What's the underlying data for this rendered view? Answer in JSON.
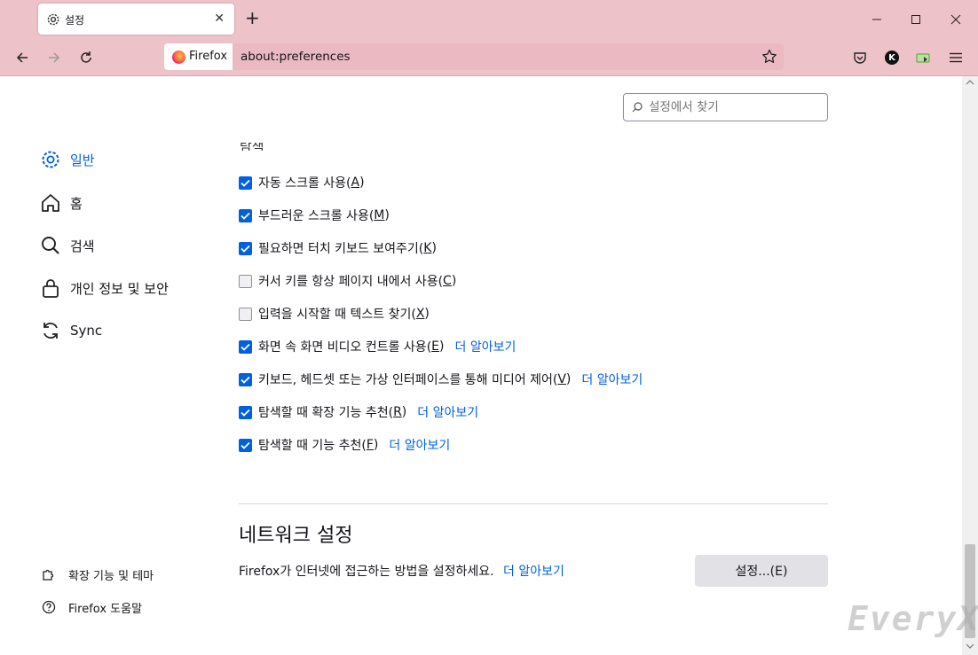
{
  "tab": {
    "title": "설정",
    "icon": "gear-icon"
  },
  "window": {
    "minimize": "minimize-icon",
    "maximize": "maximize-icon",
    "close": "close-icon"
  },
  "urlbar": {
    "identity_label": "Firefox",
    "url": "about:preferences"
  },
  "toolbar": {
    "avatar_letter": "K"
  },
  "search": {
    "placeholder": "설정에서 찾기"
  },
  "sidebar": {
    "items": [
      {
        "label": "일반",
        "icon": "gear-icon",
        "active": true
      },
      {
        "label": "홈",
        "icon": "home-icon"
      },
      {
        "label": "검색",
        "icon": "search-icon"
      },
      {
        "label": "개인 정보 및 보안",
        "icon": "lock-icon"
      },
      {
        "label": "Sync",
        "icon": "sync-icon"
      }
    ],
    "footer": [
      {
        "label": "확장 기능 및 테마",
        "icon": "puzzle-icon"
      },
      {
        "label": "Firefox 도움말",
        "icon": "help-icon"
      }
    ]
  },
  "section_partial_heading": "탐색",
  "options": [
    {
      "label": "자동 스크롤 사용(",
      "key": "A",
      "checked": true
    },
    {
      "label": "부드러운 스크롤 사용(",
      "key": "M",
      "checked": true
    },
    {
      "label": "필요하면 터치 키보드 보여주기(",
      "key": "K",
      "checked": true
    },
    {
      "label": "커서 키를 항상 페이지 내에서 사용(",
      "key": "C",
      "checked": false
    },
    {
      "label": "입력을 시작할 때 텍스트 찾기(",
      "key": "X",
      "checked": false
    },
    {
      "label": "화면 속 화면 비디오 컨트롤 사용(",
      "key": "E",
      "checked": true,
      "link": "더 알아보기"
    },
    {
      "label": "키보드, 헤드셋 또는 가상 인터페이스를 통해 미디어 제어(",
      "key": "V",
      "checked": true,
      "link": "더 알아보기"
    },
    {
      "label": "탐색할 때 확장 기능 추천(",
      "key": "R",
      "checked": true,
      "link": "더 알아보기"
    },
    {
      "label": "탐색할 때 기능 추천(",
      "key": "F",
      "checked": true,
      "link": "더 알아보기"
    }
  ],
  "network": {
    "heading": "네트워크 설정",
    "description": "Firefox가 인터넷에 접근하는 방법을 설정하세요.",
    "link": "더 알아보기",
    "button_label": "설정...(E)"
  },
  "watermark": "EveryX",
  "colors": {
    "accent": "#0061e0",
    "chrome": "#eec2c9",
    "urlbar": "#ebb9c1"
  }
}
